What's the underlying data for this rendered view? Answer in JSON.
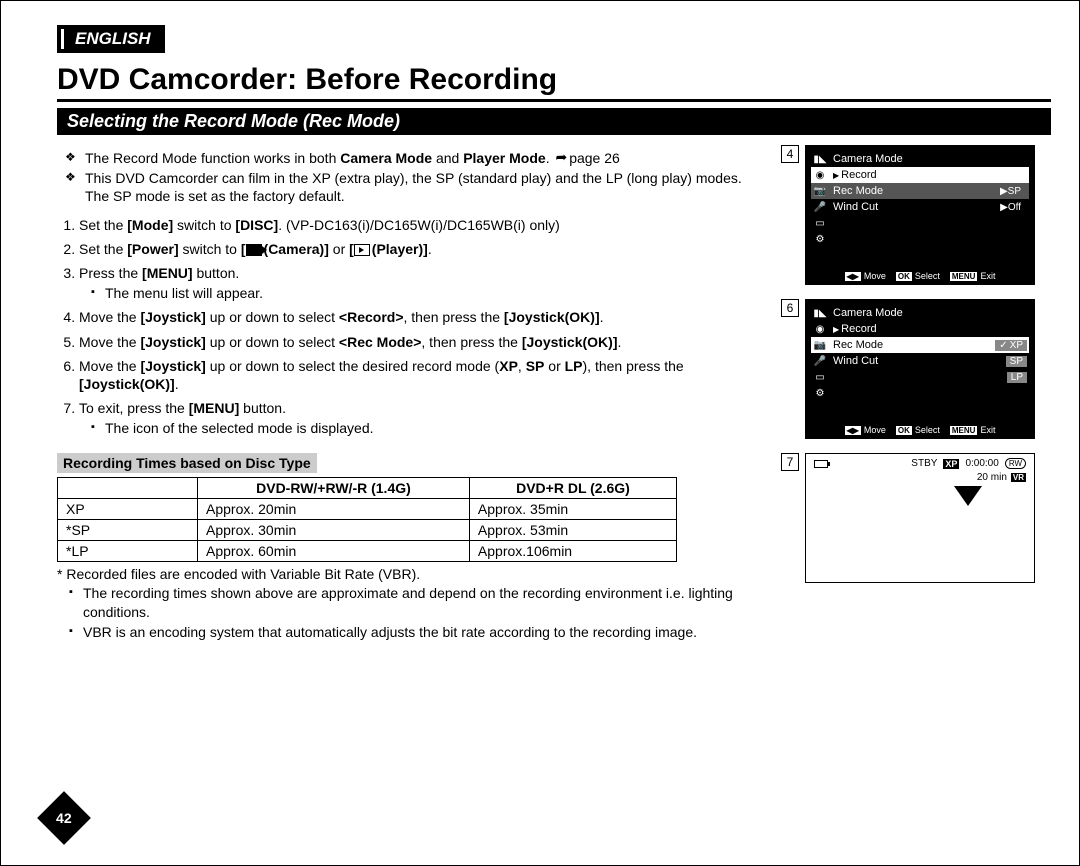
{
  "lang": "ENGLISH",
  "title": "DVD Camcorder: Before Recording",
  "section": "Selecting the Record Mode (Rec Mode)",
  "intro": [
    {
      "pre": "The Record Mode function works in both ",
      "b1": "Camera Mode",
      "mid1": " and ",
      "b2": "Player Mode",
      "post": ". ",
      "pageref": "page 26"
    },
    {
      "text": "This DVD Camcorder can film in the XP (extra play), the SP (standard play) and the LP (long play) modes. The SP mode is set as the factory default."
    }
  ],
  "steps": {
    "s1": {
      "pre": "Set the ",
      "b1": "[Mode]",
      "mid": " switch to ",
      "b2": "[DISC]",
      "post": ". (VP-DC163(i)/DC165W(i)/DC165WB(i) only)"
    },
    "s2": {
      "pre": "Set the ",
      "b1": "[Power]",
      "mid1": " switch to ",
      "b2": "[",
      "cam": "(Camera)]",
      "mid2": " or ",
      "b3": "[",
      "ply": "(Player)]",
      "post": "."
    },
    "s3": {
      "pre": "Press the ",
      "b": "[MENU]",
      "post": " button.",
      "sub": "The menu list will appear."
    },
    "s4": {
      "pre": "Move the ",
      "b1": "[Joystick]",
      "mid1": " up or down to select ",
      "b2": "<Record>",
      "mid2": ", then press the ",
      "b3": "[Joystick(OK)]",
      "post": "."
    },
    "s5": {
      "pre": "Move the ",
      "b1": "[Joystick]",
      "mid1": " up or down to select ",
      "b2": "<Rec Mode>",
      "mid2": ", then press the ",
      "b3": "[Joystick(OK)]",
      "post": "."
    },
    "s6": {
      "pre": "Move the ",
      "b1": "[Joystick]",
      "mid1": " up or down to select the desired record mode (",
      "b2": "XP",
      "mid2": ", ",
      "b3": "SP",
      "mid3": " or ",
      "b4": "LP",
      "mid4": "), then press the ",
      "b5": "[Joystick(OK)]",
      "post": "."
    },
    "s7": {
      "pre": "To exit, press the ",
      "b": "[MENU]",
      "post": " button.",
      "sub": "The icon of the selected mode is displayed."
    }
  },
  "table_title": "Recording Times based on Disc Type",
  "table": {
    "headers": [
      "",
      "DVD-RW/+RW/-R (1.4G)",
      "DVD+R DL (2.6G)"
    ],
    "rows": [
      [
        "XP",
        "Approx. 20min",
        "Approx. 35min"
      ],
      [
        "*SP",
        "Approx. 30min",
        "Approx. 53min"
      ],
      [
        "*LP",
        "Approx. 60min",
        "Approx.106min"
      ]
    ]
  },
  "footnote": "* Recorded files are encoded with Variable Bit Rate (VBR).",
  "footbullets": [
    "The recording times shown above are approximate and depend on the recording environment i.e. lighting conditions.",
    "VBR is an encoding system that automatically adjusts the bit rate according to the recording image."
  ],
  "page_number": "42",
  "screens": {
    "panel4": {
      "num": "4",
      "title": "Camera Mode",
      "breadcrumb": "Record",
      "rows": [
        {
          "label": "Rec Mode",
          "val": "SP",
          "arrow": true
        },
        {
          "label": "Wind Cut",
          "val": "Off",
          "arrow": true
        }
      ],
      "footer": {
        "move": "Move",
        "select": "Select",
        "exit": "Exit",
        "ok": "OK",
        "menu": "MENU"
      }
    },
    "panel6": {
      "num": "6",
      "title": "Camera Mode",
      "breadcrumb": "Record",
      "rows": [
        {
          "label": "Rec Mode",
          "sel": true
        },
        {
          "label": "Wind Cut"
        }
      ],
      "options": [
        "XP",
        "SP",
        "LP"
      ],
      "checked": 0,
      "footer": {
        "move": "Move",
        "select": "Select",
        "exit": "Exit",
        "ok": "OK",
        "menu": "MENU"
      }
    },
    "panel7": {
      "num": "7",
      "stby": "STBY",
      "mode": "XP",
      "time": "0:00:00",
      "disc": "RW",
      "remain": "20 min",
      "vr": "VR"
    }
  }
}
